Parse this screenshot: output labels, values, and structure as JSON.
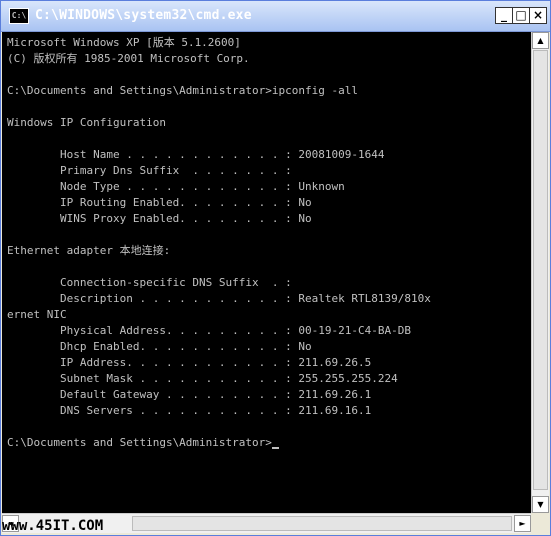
{
  "window": {
    "title": "C:\\WINDOWS\\system32\\cmd.exe",
    "icon": "cmd-icon",
    "minimize_glyph": "_",
    "maximize_glyph": "□",
    "close_glyph": "×"
  },
  "console": {
    "lines": [
      "Microsoft Windows XP [版本 5.1.2600]",
      "(C) 版权所有 1985-2001 Microsoft Corp.",
      "",
      "C:\\Documents and Settings\\Administrator>ipconfig -all",
      "",
      "Windows IP Configuration",
      "",
      "        Host Name . . . . . . . . . . . . : 20081009-1644",
      "        Primary Dns Suffix  . . . . . . . :",
      "        Node Type . . . . . . . . . . . . : Unknown",
      "        IP Routing Enabled. . . . . . . . : No",
      "        WINS Proxy Enabled. . . . . . . . : No",
      "",
      "Ethernet adapter 本地连接:",
      "",
      "        Connection-specific DNS Suffix  . :",
      "        Description . . . . . . . . . . . : Realtek RTL8139/810x",
      "ernet NIC",
      "        Physical Address. . . . . . . . . : 00-19-21-C4-BA-DB",
      "        Dhcp Enabled. . . . . . . . . . . : No",
      "        IP Address. . . . . . . . . . . . : 211.69.26.5",
      "        Subnet Mask . . . . . . . . . . . : 255.255.255.224",
      "        Default Gateway . . . . . . . . . : 211.69.26.1",
      "        DNS Servers . . . . . . . . . . . : 211.69.16.1",
      "",
      "C:\\Documents and Settings\\Administrator>"
    ]
  },
  "scrollbars": {
    "up_arrow": "▲",
    "down_arrow": "▼",
    "left_arrow": "◄",
    "right_arrow": "►"
  },
  "watermark": "www.45IT.COM",
  "colors": {
    "console_bg": "#000000",
    "console_fg": "#c0c0c0",
    "titlebar": "#a9c3f2"
  }
}
